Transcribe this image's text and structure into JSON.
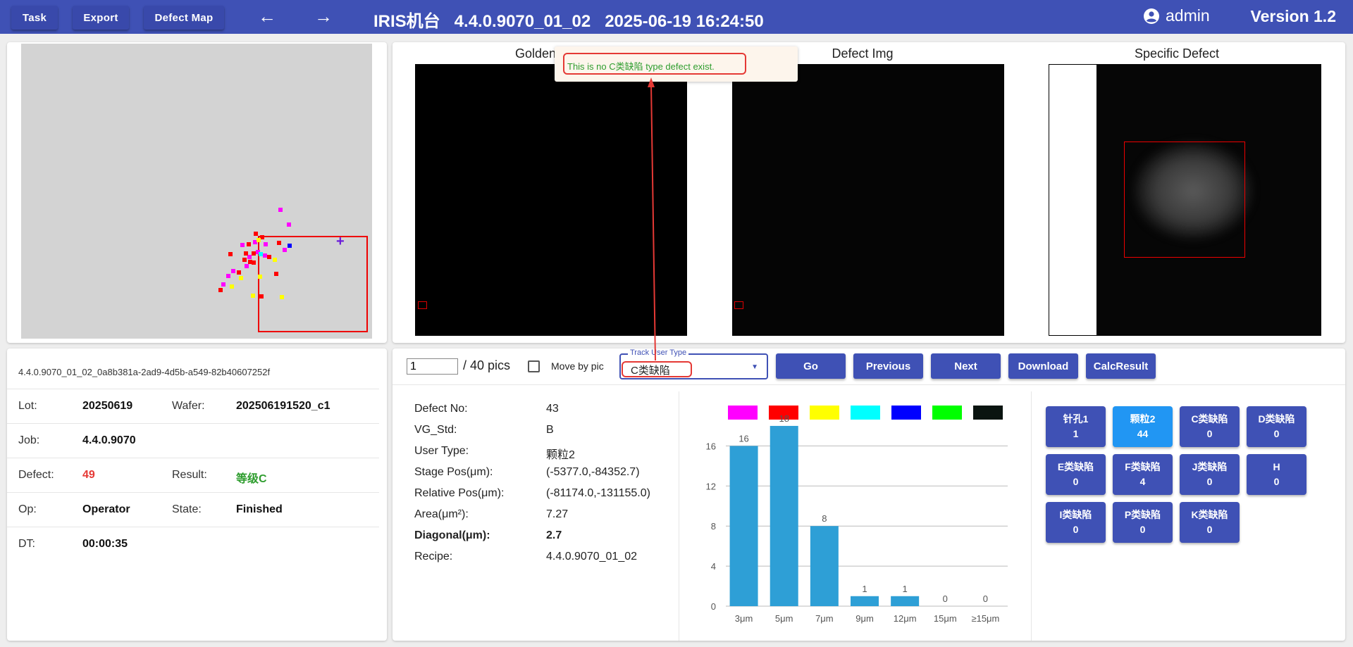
{
  "topbar": {
    "task_label": "Task",
    "export_label": "Export",
    "defect_map_label": "Defect Map",
    "back_icon": "arrow-left-icon",
    "forward_icon": "arrow-right-icon",
    "title": "IRIS机台   4.4.0.9070_01_02   2025-06-19 16:24:50",
    "user_icon": "account-circle-icon",
    "user": "admin",
    "version": "Version 1.2"
  },
  "wafer": {
    "uuid": "4.4.0.9070_01_02_0a8b381a-2ad9-4d5b-a549-82b40607252f",
    "lot_label": "Lot:",
    "lot": "20250619",
    "wafer_label": "Wafer:",
    "wafer": "202506191520_c1",
    "job_label": "Job:",
    "job": "4.4.0.9070",
    "defect_label": "Defect:",
    "defect": "49",
    "result_label": "Result:",
    "result": "等级C",
    "op_label": "Op:",
    "op": "Operator",
    "state_label": "State:",
    "state": "Finished",
    "dt_label": "DT:",
    "dt": "00:00:35"
  },
  "images": {
    "golden_title": "Golden",
    "defect_title": "Defect Img",
    "specific_title": "Specific Defect"
  },
  "tooltip": {
    "message": "This is no C类缺陷 type defect exist."
  },
  "controls": {
    "page_value": "1",
    "page_total": "/ 40 pics",
    "move_by_pic_label": "Move by pic",
    "move_by_pic_checked": false,
    "track_label": "Track User Type",
    "track_value": "C类缺陷",
    "go_label": "Go",
    "previous_label": "Previous",
    "next_label": "Next",
    "download_label": "Download",
    "calc_label": "CalcResult"
  },
  "details": {
    "defect_no_label": "Defect No:",
    "defect_no": "43",
    "vg_std_label": "VG_Std:",
    "vg_std": "B",
    "user_type_label": "User Type:",
    "user_type": "颗粒2",
    "stage_pos_label": "Stage Pos(μm):",
    "stage_pos": "(-5377.0,-84352.7)",
    "relative_pos_label": "Relative Pos(μm):",
    "relative_pos": "(-81174.0,-131155.0)",
    "area_label": "Area(μm²):",
    "area": "7.27",
    "diagonal_label": "Diagonal(μm):",
    "diagonal": "2.7",
    "recipe_label": "Recipe:",
    "recipe": "4.4.0.9070_01_02"
  },
  "legend_colors": [
    "#ff00ff",
    "#ff0000",
    "#ffff00",
    "#00ffff",
    "#0000ff",
    "#00ff00",
    "#0a1410"
  ],
  "chart_data": {
    "type": "bar",
    "categories": [
      "3μm",
      "5μm",
      "7μm",
      "9μm",
      "12μm",
      "15μm",
      "≥15μm"
    ],
    "values": [
      16,
      18,
      8,
      1,
      1,
      0,
      0
    ],
    "ylim": [
      0,
      18
    ],
    "yticks": [
      0,
      4,
      8,
      12,
      16
    ],
    "bar_color": "#2e9fd6",
    "grid": true
  },
  "defect_types": [
    {
      "name": "针孔1",
      "count": "1",
      "active": false
    },
    {
      "name": "颗粒2",
      "count": "44",
      "active": true
    },
    {
      "name": "C类缺陷",
      "count": "0",
      "active": false
    },
    {
      "name": "D类缺陷",
      "count": "0",
      "active": false
    },
    {
      "name": "E类缺陷",
      "count": "0",
      "active": false
    },
    {
      "name": "F类缺陷",
      "count": "4",
      "active": false
    },
    {
      "name": "J类缺陷",
      "count": "0",
      "active": false
    },
    {
      "name": "H",
      "count": "0",
      "active": false
    },
    {
      "name": "I类缺陷",
      "count": "0",
      "active": false
    },
    {
      "name": "P类缺陷",
      "count": "0",
      "active": false
    },
    {
      "name": "K类缺陷",
      "count": "0",
      "active": false
    }
  ]
}
